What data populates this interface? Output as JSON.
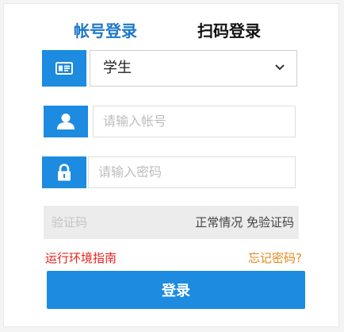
{
  "tabs": {
    "account": "帐号登录",
    "qrcode": "扫码登录"
  },
  "role_select": {
    "value": "学生",
    "icon": "id-card-icon"
  },
  "account_field": {
    "placeholder": "请输入帐号",
    "icon": "user-icon"
  },
  "password_field": {
    "placeholder": "请输入密码",
    "icon": "lock-icon"
  },
  "captcha": {
    "placeholder": "验证码",
    "note": "正常情况 免验证码"
  },
  "links": {
    "guide": "运行环境指南",
    "forgot": "忘记密码?"
  },
  "login_button": {
    "label": "登录"
  },
  "colors": {
    "accent": "#1c8be0",
    "tab_active": "#1d77c9",
    "link_red": "#e8201a",
    "link_orange": "#e8871a"
  }
}
